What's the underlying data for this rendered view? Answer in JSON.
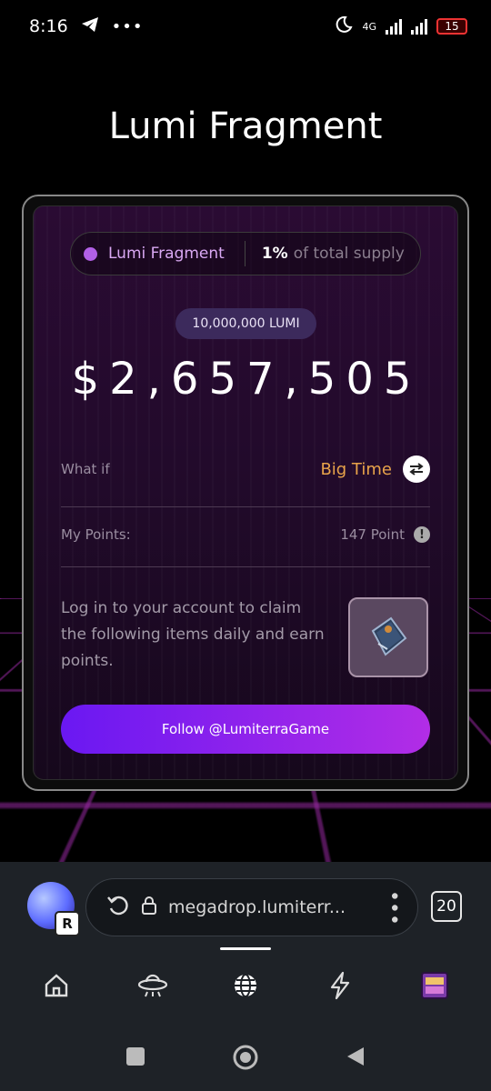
{
  "status_bar": {
    "time": "8:16",
    "network": "4G",
    "battery": "15",
    "icons": [
      "telegram-icon",
      "more-dots-icon",
      "moon-icon",
      "signal-icon",
      "battery-icon"
    ]
  },
  "page": {
    "title": "Lumi Fragment"
  },
  "card": {
    "token_name": "Lumi Fragment",
    "supply_pct": "1%",
    "supply_text": "of total supply",
    "amount_badge": "10,000,000 LUMI",
    "value": "$2,657,505",
    "what_if_label": "What if",
    "what_if_value": "Big Time",
    "points_label": "My Points:",
    "points_value": "147 Point",
    "login_text": "Log in to your account to claim the following items daily and earn points.",
    "follow_button": "Follow @LumiterraGame"
  },
  "browser": {
    "url": "megadrop.lumiterr...",
    "tab_count": "20",
    "nav_items": [
      "home-icon",
      "ufo-icon",
      "globe-icon",
      "lightning-icon",
      "game-icon"
    ],
    "active_nav": "globe-icon"
  },
  "colors": {
    "accent_purple": "#b160e6",
    "orange": "#e8a34a",
    "button_start": "#6a18f2",
    "button_end": "#b22de6"
  }
}
